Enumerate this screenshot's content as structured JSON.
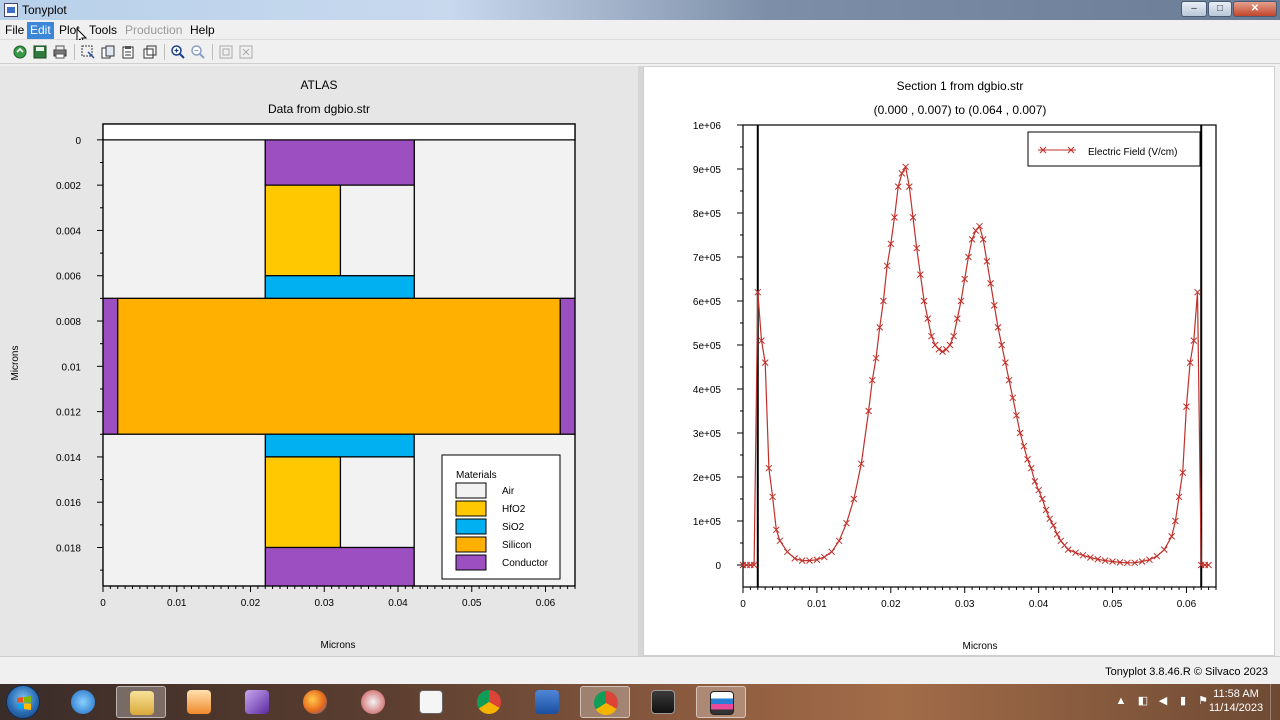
{
  "window": {
    "title": "Tonyplot"
  },
  "menu": {
    "items": [
      "File",
      "Edit",
      "Plot",
      "Tools",
      "Production",
      "Help"
    ],
    "active": "Edit",
    "disabled": [
      "Production"
    ]
  },
  "toolbar": {
    "icons": [
      "open-icon",
      "save-icon",
      "print-icon",
      "select-icon",
      "copy-icon",
      "paste-icon",
      "overlay-icon",
      "zoom-in-icon",
      "zoom-out-icon",
      "zoom-fit-icon",
      "zoom-reset-icon"
    ]
  },
  "left_plot": {
    "title": "ATLAS",
    "subtitle": "Data from dgbio.str",
    "xlabel": "Microns",
    "ylabel": "Microns",
    "x_ticks": [
      "0",
      "0.01",
      "0.02",
      "0.03",
      "0.04",
      "0.05",
      "0.06"
    ],
    "y_ticks": [
      "0",
      "0.002",
      "0.004",
      "0.006",
      "0.008",
      "0.01",
      "0.012",
      "0.014",
      "0.016",
      "0.018"
    ],
    "legend_title": "Materials",
    "materials": [
      {
        "name": "Air",
        "color": "#f2f2f2"
      },
      {
        "name": "HfO2",
        "color": "#ffc800"
      },
      {
        "name": "SiO2",
        "color": "#00b0f0"
      },
      {
        "name": "Silicon",
        "color": "#ffb000"
      },
      {
        "name": "Conductor",
        "color": "#9b4fc0"
      }
    ]
  },
  "chart_data": {
    "type": "line",
    "title": "Section 1 from dgbio.str",
    "subtitle": "(0.000 , 0.007) to (0.064 , 0.007)",
    "xlabel": "Microns",
    "ylabel": "",
    "xlim": [
      0,
      0.064
    ],
    "ylim": [
      -50000,
      1000000
    ],
    "x_ticks": [
      "0",
      "0.01",
      "0.02",
      "0.03",
      "0.04",
      "0.05",
      "0.06"
    ],
    "y_ticks": [
      "0",
      "1e+05",
      "2e+05",
      "3e+05",
      "4e+05",
      "5e+05",
      "6e+05",
      "7e+05",
      "8e+05",
      "9e+05",
      "1e+06"
    ],
    "legend_position": "top-right",
    "color": "#c0302a",
    "series": [
      {
        "name": "Electric Field (V/cm)",
        "x": [
          0.0,
          0.0005,
          0.001,
          0.0015,
          0.002,
          0.0025,
          0.003,
          0.0035,
          0.004,
          0.0045,
          0.005,
          0.006,
          0.007,
          0.008,
          0.009,
          0.01,
          0.011,
          0.012,
          0.013,
          0.014,
          0.015,
          0.016,
          0.017,
          0.0175,
          0.018,
          0.0185,
          0.019,
          0.0195,
          0.02,
          0.0205,
          0.021,
          0.0215,
          0.022,
          0.0225,
          0.023,
          0.0235,
          0.024,
          0.0245,
          0.025,
          0.0255,
          0.026,
          0.0265,
          0.027,
          0.0275,
          0.028,
          0.0285,
          0.029,
          0.0295,
          0.03,
          0.0305,
          0.031,
          0.0315,
          0.032,
          0.0325,
          0.033,
          0.0335,
          0.034,
          0.0345,
          0.035,
          0.0355,
          0.036,
          0.0365,
          0.037,
          0.0375,
          0.038,
          0.0385,
          0.039,
          0.0395,
          0.04,
          0.0405,
          0.041,
          0.0415,
          0.042,
          0.0425,
          0.043,
          0.0435,
          0.044,
          0.045,
          0.046,
          0.047,
          0.048,
          0.049,
          0.05,
          0.051,
          0.052,
          0.053,
          0.054,
          0.055,
          0.056,
          0.057,
          0.058,
          0.0585,
          0.059,
          0.0595,
          0.06,
          0.0605,
          0.061,
          0.0615,
          0.062,
          0.0625,
          0.063
        ],
        "y": [
          0,
          0,
          0,
          0,
          620000,
          510000,
          460000,
          220000,
          155000,
          80000,
          55000,
          30000,
          15000,
          10000,
          10000,
          12000,
          18000,
          30000,
          55000,
          95000,
          150000,
          230000,
          350000,
          420000,
          470000,
          540000,
          600000,
          680000,
          730000,
          790000,
          860000,
          890000,
          905000,
          860000,
          790000,
          720000,
          660000,
          600000,
          560000,
          520000,
          500000,
          490000,
          485000,
          490000,
          500000,
          520000,
          560000,
          600000,
          650000,
          700000,
          740000,
          760000,
          770000,
          740000,
          690000,
          640000,
          590000,
          540000,
          500000,
          460000,
          420000,
          380000,
          340000,
          300000,
          270000,
          240000,
          220000,
          190000,
          170000,
          150000,
          125000,
          105000,
          90000,
          70000,
          55000,
          45000,
          35000,
          28000,
          22000,
          17000,
          13000,
          10000,
          8000,
          6000,
          5000,
          5000,
          8000,
          12000,
          20000,
          35000,
          65000,
          100000,
          155000,
          210000,
          360000,
          460000,
          510000,
          620000,
          0,
          0,
          0
        ]
      }
    ]
  },
  "status": {
    "copyright": "Tonyplot 3.8.46.R © Silvaco 2023"
  },
  "taskbar": {
    "apps": [
      "windows-explorer-icon",
      "ie-icon",
      "folder-icon",
      "media-player-icon",
      "visual-studio-icon",
      "firefox-icon",
      "paint-icon",
      "notepad-icon",
      "chrome-icon",
      "word-icon",
      "chrome-icon",
      "deckbuild-icon",
      "tonyplot-icon"
    ],
    "time": "11:58 AM",
    "date": "11/14/2023"
  }
}
